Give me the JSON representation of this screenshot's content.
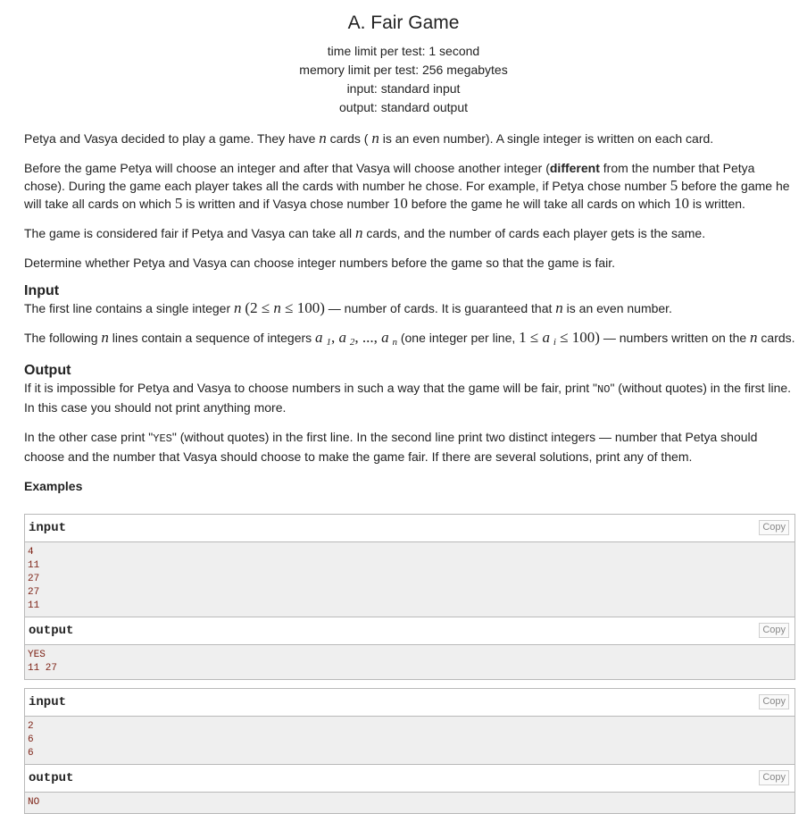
{
  "problem": {
    "title": "A. Fair Game",
    "limits": [
      "time limit per test: 1 second",
      "memory limit per test: 256 megabytes",
      "input: standard input",
      "output: standard output"
    ]
  },
  "statement": {
    "p1_a": "Petya and Vasya decided to play a game. They have ",
    "p1_b": " cards (",
    "p1_c": " is an even number). A single integer is written on each card.",
    "p2_a": "Before the game Petya will choose an integer and after that Vasya will choose another integer (",
    "p2_bold": "different",
    "p2_b": " from the number that Petya chose). During the game each player takes all the cards with number he chose. For example, if Petya chose number ",
    "p2_c": " before the game he will take all cards on which ",
    "p2_d": " is written and if Vasya chose number ",
    "p2_e": " before the game he will take all cards on which ",
    "p2_f": " is written.",
    "p3_a": "The game is considered fair if Petya and Vasya can take all ",
    "p3_b": " cards, and the number of cards each player gets is the same.",
    "p4": "Determine whether Petya and Vasya can choose integer numbers before the game so that the game is fair."
  },
  "math": {
    "n": "n",
    "five": "5",
    "ten": "10",
    "range_n": "(2 ≤ ",
    "range_n_close": " ≤ 100)",
    "a": "a",
    "one": "1",
    "two": "2",
    "dots": ", ..., ",
    "comma": ", ",
    "ai_open": "1 ≤ ",
    "i": "i",
    "ai_close": " ≤ 100)"
  },
  "input_section": {
    "heading": "Input",
    "p1_a": "The first line contains a single integer ",
    "p1_b": " — number of cards. It is guaranteed that ",
    "p1_c": " is an even number.",
    "p2_a": "The following ",
    "p2_b": " lines contain a sequence of integers ",
    "p2_c": " (one integer per line, ",
    "p2_d": " — numbers written on the ",
    "p2_e": " cards."
  },
  "output_section": {
    "heading": "Output",
    "p1_a": "If it is impossible for Petya and Vasya to choose numbers in such a way that the game will be fair, print \"",
    "p1_code": "NO",
    "p1_b": "\" (without quotes) in the first line. In this case you should not print anything more.",
    "p2_a": "In the other case print \"",
    "p2_code": "YES",
    "p2_b": "\" (without quotes) in the first line. In the second line print two distinct integers — number that Petya should choose and the number that Vasya should choose to make the game fair. If there are several solutions, print any of them."
  },
  "examples": {
    "heading": "Examples",
    "copy_label": "Copy",
    "input_label": "input",
    "output_label": "output",
    "ex1_input": [
      "4",
      "11",
      "27",
      "27",
      "11"
    ],
    "ex1_output": [
      "YES",
      "11 27"
    ],
    "ex2_input": [
      "2",
      "6",
      "6"
    ],
    "ex2_output": [
      "NO"
    ]
  }
}
